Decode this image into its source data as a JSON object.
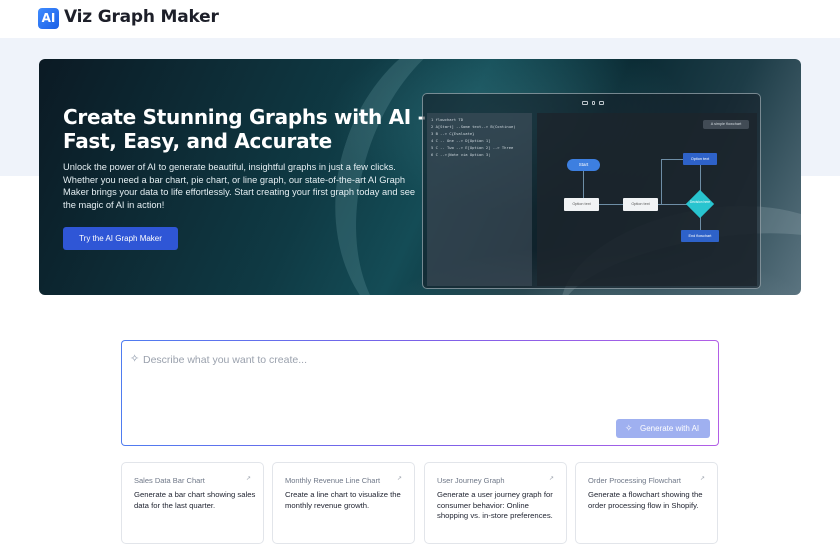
{
  "brand": {
    "logo_text": "AI",
    "name": "Viz Graph Maker"
  },
  "hero": {
    "title": "Create Stunning Graphs with AI - Fast, Easy, and Accurate",
    "description": "Unlock the power of AI to generate beautiful, insightful graphs in just a few clicks. Whether you need a bar chart, pie chart, or line graph, our state-of-the-art AI Graph Maker brings your data to life effortlessly. Start creating your first graph today and see the magic of AI in action!",
    "cta": "Try the AI Graph Maker",
    "mockup": {
      "code_lines": [
        "1  flowchart TD",
        "2  A[Start] --Some text--> B(Continue)",
        "3  B --> C{Evaluate}",
        "4  C -- One --> D[Option 1]",
        "5  C -- Two --> E[Option 2] --> Three",
        "6  C -->|Note via Option 3|"
      ],
      "pill": "A simple flowchart",
      "nodes": {
        "start": "Start",
        "option_text_1": "Option text",
        "option_text_2": "Option text",
        "option_text_top": "Option text",
        "decision": "Decision here",
        "end": "End flowchart"
      }
    }
  },
  "prompt": {
    "placeholder": "Describe what you want to create...",
    "value": "",
    "button": "Generate with AI"
  },
  "cards": [
    {
      "title": "Sales Data Bar Chart",
      "desc": "Generate a bar chart showing sales data for the last quarter."
    },
    {
      "title": "Monthly Revenue Line Chart",
      "desc": "Create a line chart to visualize the monthly revenue growth."
    },
    {
      "title": "User Journey Graph",
      "desc": "Generate a user journey graph for consumer behavior: Online shopping vs. in-store preferences."
    },
    {
      "title": "Order Processing Flowchart",
      "desc": "Generate a flowchart showing the order processing flow in Shopify."
    }
  ],
  "icons": {
    "sparkle": "sparkle-icon",
    "card_arrow": "arrow-icon"
  },
  "colors": {
    "accent": "#2f56d6",
    "generate_button": "#9fb0f0",
    "prompt_border_start": "#4f7cf0",
    "prompt_border_end": "#b25fe6"
  }
}
